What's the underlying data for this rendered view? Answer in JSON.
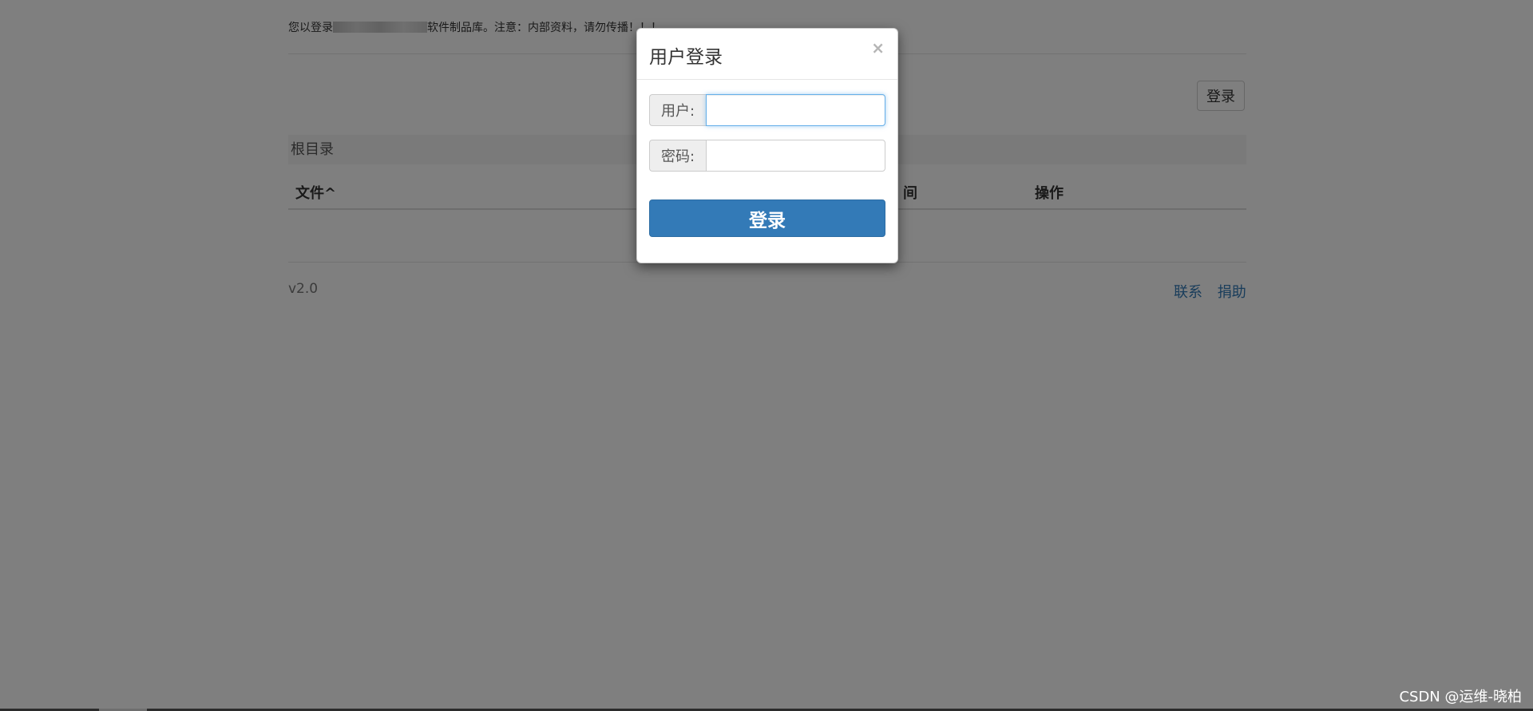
{
  "notice": {
    "prefix": "您以登录",
    "suffix": "软件制品库。注意：内部资料，请勿传播！！！"
  },
  "header": {
    "login_button": "登录"
  },
  "breadcrumb": {
    "label": "根目录"
  },
  "table": {
    "columns": [
      "文件^",
      "间",
      "操作"
    ]
  },
  "footer": {
    "version": "v2.0",
    "links": [
      "联系",
      "捐助"
    ]
  },
  "modal": {
    "title": "用户登录",
    "close": "×",
    "username_label": "用户:",
    "username_value": "",
    "password_label": "密码:",
    "password_value": "",
    "submit": "登录"
  },
  "watermark": "CSDN @运维-晓柏",
  "colors": {
    "primary": "#337ab7",
    "backdrop": "rgba(0,0,0,0.5)"
  }
}
